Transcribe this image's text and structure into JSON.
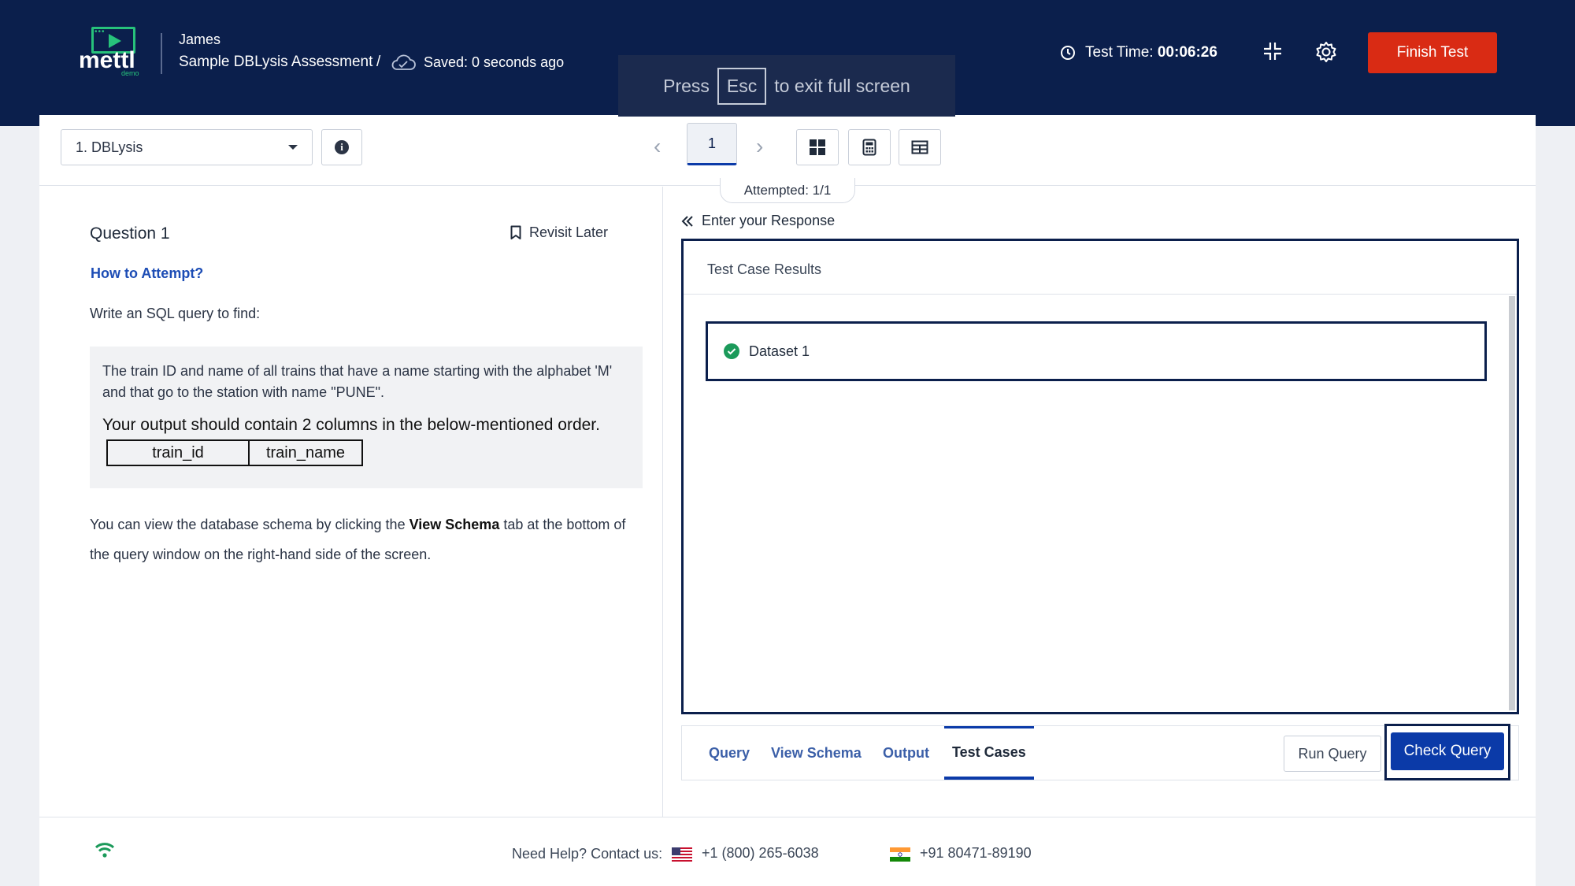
{
  "header": {
    "user": "James",
    "test_name": "Sample DBLysis Assessment",
    "separator": "/",
    "saved": "Saved: 0 seconds ago",
    "logo_text": "mettl",
    "logo_sub": "demo",
    "esc_press": "Press",
    "esc_key": "Esc",
    "esc_rest": "to exit full screen",
    "timer_label": "Test Time:",
    "timer_value": "00:06:26",
    "finish": "Finish Test"
  },
  "toolbar": {
    "section": "1. DBLysis",
    "page": "1",
    "prev": "‹",
    "next": "›",
    "attempted": "Attempted: 1/1"
  },
  "question": {
    "title": "Question 1",
    "revisit": "Revisit Later",
    "how_to": "How to Attempt?",
    "intro": "Write an SQL query to find:",
    "text": "The train ID and name of all trains that have a name starting with the alphabet 'M' and that go to the station with name \"PUNE\".",
    "order_text": "Your output should contain 2 columns in the below-mentioned order.",
    "columns": [
      "train_id",
      "train_name"
    ],
    "schema_pre": "You can view the database schema by clicking the ",
    "schema_bold": "View Schema",
    "schema_post": " tab at the bottom of the query window on the right-hand side of the screen."
  },
  "response": {
    "label": "Enter your Response",
    "results_title": "Test Case Results",
    "dataset": "Dataset 1",
    "tabs": [
      "Query",
      "View Schema",
      "Output",
      "Test Cases"
    ],
    "active_tab": "Test Cases",
    "run": "Run Query",
    "check": "Check Query"
  },
  "footer": {
    "help": "Need Help? Contact us:",
    "phone_us": "+1 (800) 265-6038",
    "phone_in": "+91 80471-89190"
  },
  "colors": {
    "header_bg": "#0b1f4c",
    "finish_btn": "#d92b14",
    "primary": "#0b3aa8",
    "success": "#1b9a5a",
    "logo_green": "#27c27b"
  }
}
